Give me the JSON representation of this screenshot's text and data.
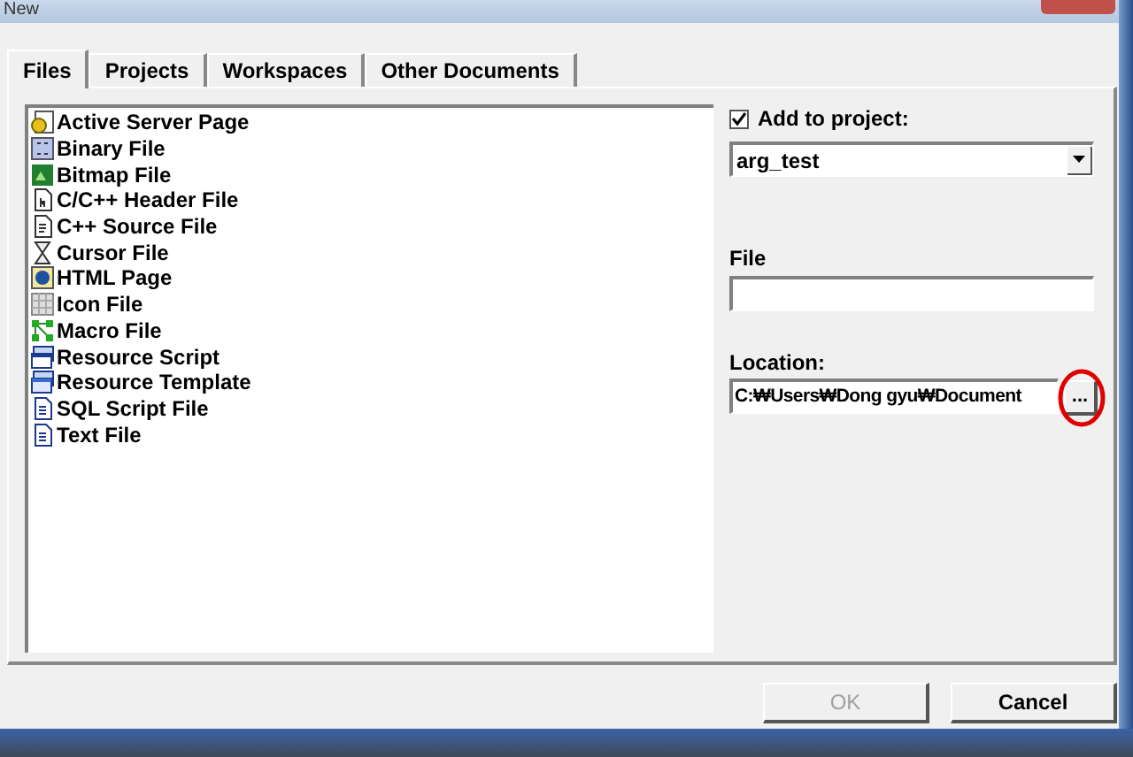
{
  "window": {
    "title": "New"
  },
  "tabs": [
    {
      "label": "Files",
      "selected": true
    },
    {
      "label": "Projects",
      "selected": false
    },
    {
      "label": "Workspaces",
      "selected": false
    },
    {
      "label": "Other Documents",
      "selected": false
    }
  ],
  "file_types": [
    "Active Server Page",
    "Binary File",
    "Bitmap File",
    "C/C++ Header File",
    "C++ Source File",
    "Cursor File",
    "HTML Page",
    "Icon File",
    "Macro File",
    "Resource Script",
    "Resource Template",
    "SQL Script File",
    "Text File"
  ],
  "add_to_project": {
    "label": "Add to project:",
    "checked": true,
    "value": "arg_test"
  },
  "file": {
    "label": "File"
  },
  "location": {
    "label": "Location:",
    "value": "C:₩Users₩Dong gyu₩Document",
    "browse": "..."
  },
  "buttons": [
    {
      "label": "OK",
      "disabled": true
    },
    {
      "label": "Cancel",
      "disabled": false
    }
  ]
}
